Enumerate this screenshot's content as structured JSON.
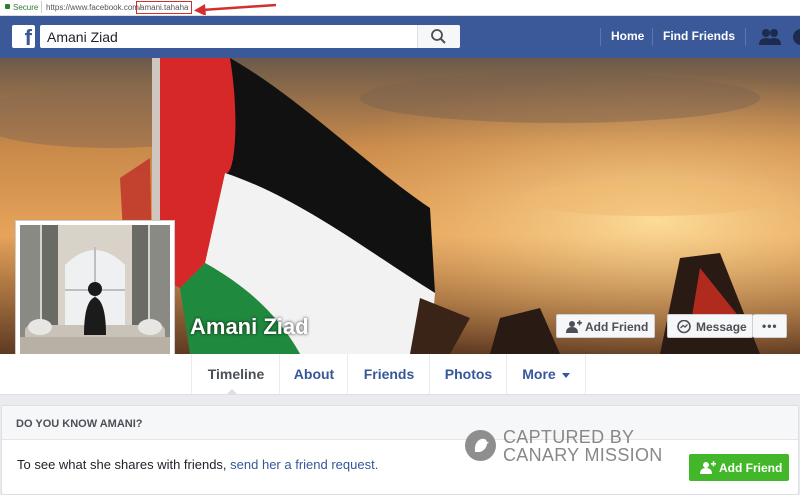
{
  "browser": {
    "secure_label": "Secure",
    "url_base": "https://www.facebook.com/",
    "url_path": "amani.tahaha"
  },
  "header": {
    "search_value": "Amani Ziad",
    "nav": [
      "Home",
      "Find Friends"
    ]
  },
  "profile": {
    "name": "Amani Ziad",
    "add_friend_label": "Add Friend",
    "message_label": "Message",
    "more_label": "•••"
  },
  "tabs": [
    {
      "label": "Timeline"
    },
    {
      "label": "About"
    },
    {
      "label": "Friends"
    },
    {
      "label": "Photos"
    },
    {
      "label": "More"
    }
  ],
  "know_card": {
    "title": "DO YOU KNOW AMANI?",
    "text": "To see what she shares with friends, ",
    "link": "send her a friend request.",
    "button_label": "Add Friend"
  },
  "watermark": {
    "line1": "CAPTURED BY",
    "line2": "CANARY MISSION"
  },
  "colors": {
    "fb_blue": "#3b5998",
    "link": "#365899",
    "green": "#42b72a",
    "annotation_red": "#d32f2f"
  }
}
